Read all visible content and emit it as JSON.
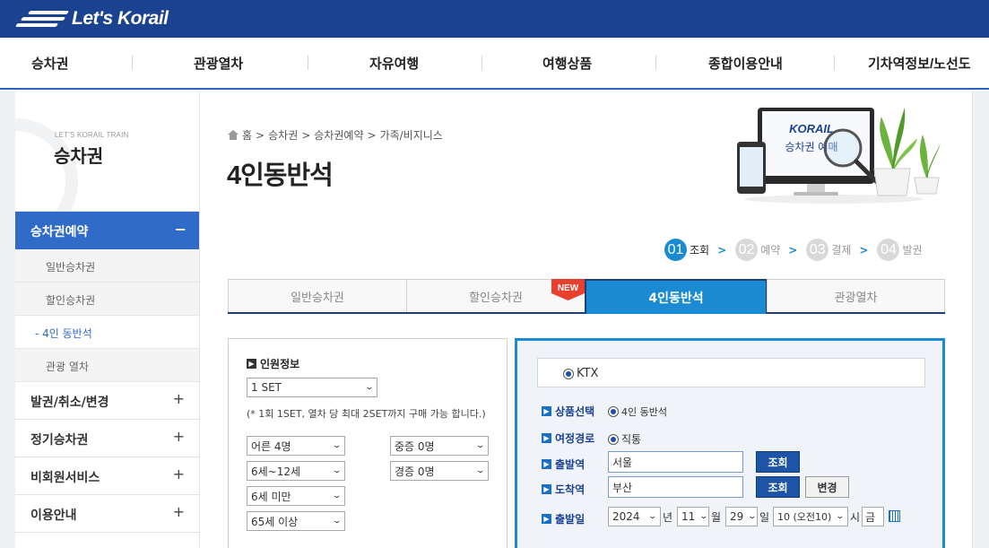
{
  "header": {
    "logo_text": "Let's Korail"
  },
  "nav": {
    "items": [
      "승차권",
      "관광열차",
      "자유여행",
      "여행상품",
      "종합이용안내",
      "기차역정보/노선도"
    ]
  },
  "sidebar": {
    "subtitle": "LET'S KORAIL TRAIN",
    "title": "승차권",
    "active": {
      "label": "승차권예약",
      "toggle": "−"
    },
    "sub_items": [
      "일반승차권",
      "할인승차권",
      "- 4인 동반석",
      "관광 열차"
    ],
    "groups": [
      {
        "label": "발권/취소/변경",
        "toggle": "+"
      },
      {
        "label": "정기승차권",
        "toggle": "+"
      },
      {
        "label": "비회원서비스",
        "toggle": "+"
      },
      {
        "label": "이용안내",
        "toggle": "+"
      }
    ]
  },
  "breadcrumb": {
    "items": [
      "홈",
      ">",
      "승차권",
      ">",
      "승차권예약",
      ">",
      "가족/비지니스"
    ]
  },
  "page_title": "4인동반석",
  "illustration": {
    "brand": "KORAIL",
    "caption": "승차권 예매"
  },
  "steps": [
    {
      "num": "01",
      "label": "조회",
      "arrow": ">"
    },
    {
      "num": "02",
      "label": "예약",
      "arrow": ">"
    },
    {
      "num": "03",
      "label": "결제",
      "arrow": ">"
    },
    {
      "num": "04",
      "label": "발권",
      "arrow": ""
    }
  ],
  "tabs": [
    "일반승차권",
    "할인승차권",
    "4인동반석",
    "관광열차"
  ],
  "new_badge": "NEW",
  "pax": {
    "heading": "인원정보",
    "set_select": "1 SET",
    "note": "(* 1회 1SET, 열차 당 최대 2SET까지 구매 가능 합니다.)",
    "selects": [
      "어른 4명",
      "6세~12세",
      "6세 미만",
      "65세 이상",
      "중증 0명",
      "경증 0명"
    ]
  },
  "search": {
    "train_type": "KTX",
    "product_label": "상품선택",
    "product_value": "4인 동반석",
    "route_label": "여정경로",
    "route_value": "직통",
    "depart_label": "출발역",
    "depart_value": "서울",
    "arrive_label": "도착역",
    "arrive_value": "부산",
    "lookup_label": "조회",
    "change_label": "변경",
    "date_label": "출발일",
    "year": "2024",
    "year_unit": "년",
    "month": "11",
    "month_unit": "월",
    "day": "29",
    "day_unit": "일",
    "hour": "10 (오전10)",
    "hour_unit": "시",
    "weekday": "금"
  }
}
